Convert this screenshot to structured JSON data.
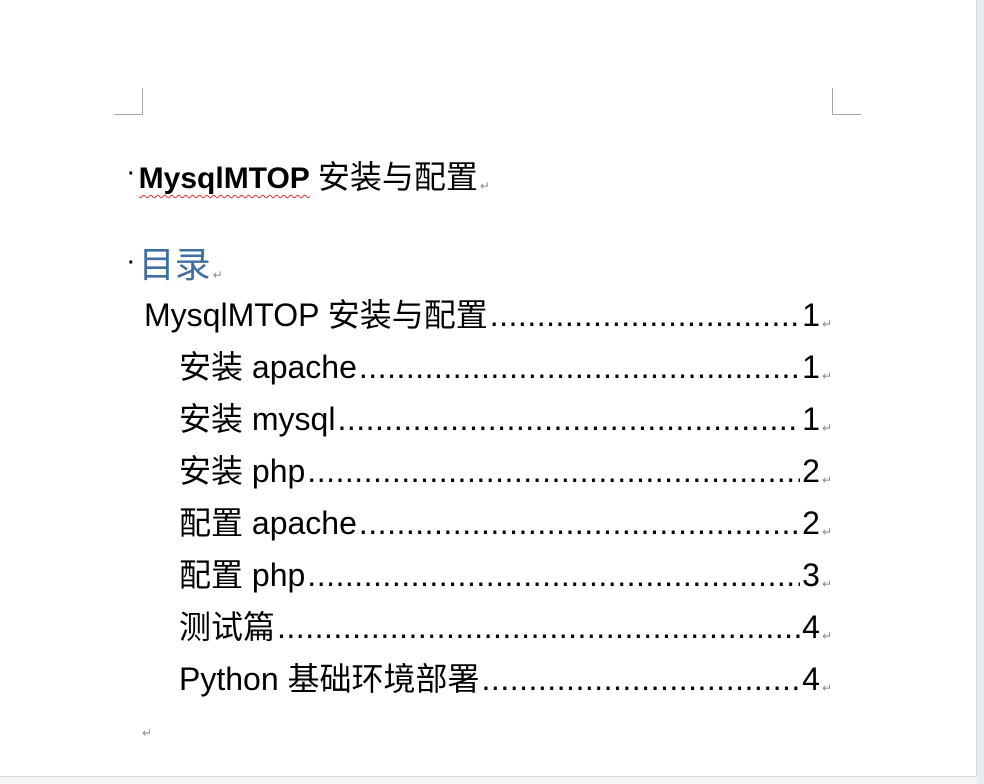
{
  "heading": {
    "title": "MysqlMTOP 安装与配置",
    "title_latin": "MysqlMTOP",
    "title_cjk": "安装与配置"
  },
  "toc_heading": "目录",
  "paragraph_mark": "↵",
  "toc": [
    {
      "text": "MysqlMTOP 安装与配置",
      "page": "1",
      "level": 1
    },
    {
      "text": "安装 apache",
      "page": "1",
      "level": 2
    },
    {
      "text": "安装 mysql",
      "page": "1",
      "level": 2
    },
    {
      "text": "安装 php",
      "page": "2",
      "level": 2
    },
    {
      "text": "配置 apache",
      "page": "2",
      "level": 2
    },
    {
      "text": "配置 php",
      "page": "3",
      "level": 2
    },
    {
      "text": "测试篇",
      "page": "4",
      "level": 2
    },
    {
      "text": "Python 基础环境部署",
      "page": "4",
      "level": 2
    }
  ],
  "colors": {
    "toc_heading": "#3f6ea3",
    "spell_underline": "#d9342b",
    "formatting_mark": "#8a8a8a"
  }
}
